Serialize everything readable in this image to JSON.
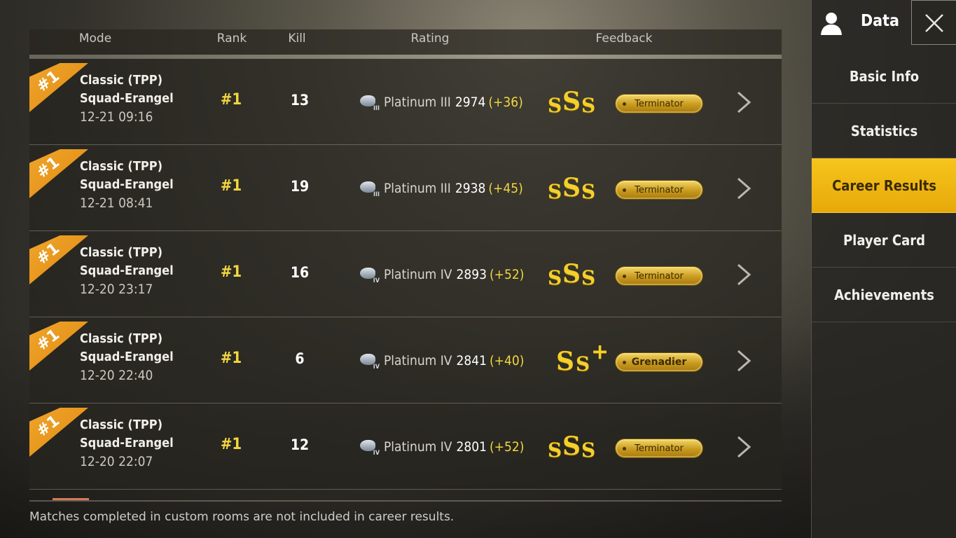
{
  "header": {
    "mode": "Mode",
    "rank": "Rank",
    "kill": "Kill",
    "rating": "Rating",
    "feedback": "Feedback"
  },
  "matches": [
    {
      "badge": "#1",
      "mode_line1": "Classic (TPP)",
      "mode_line2": "Squad-Erangel",
      "time": "12-21 09:16",
      "rank": "#1",
      "kill": "13",
      "tier_icon": "III",
      "tier": "Platinum III",
      "score": "2974",
      "delta": "(+36)",
      "grade": [
        "S",
        "S",
        "S"
      ],
      "grade_plus": false,
      "feedback": "Terminator"
    },
    {
      "badge": "#1",
      "mode_line1": "Classic (TPP)",
      "mode_line2": "Squad-Erangel",
      "time": "12-21 08:41",
      "rank": "#1",
      "kill": "19",
      "tier_icon": "III",
      "tier": "Platinum III",
      "score": "2938",
      "delta": "(+45)",
      "grade": [
        "S",
        "S",
        "S"
      ],
      "grade_plus": false,
      "feedback": "Terminator"
    },
    {
      "badge": "#1",
      "mode_line1": "Classic (TPP)",
      "mode_line2": "Squad-Erangel",
      "time": "12-20 23:17",
      "rank": "#1",
      "kill": "16",
      "tier_icon": "IV",
      "tier": "Platinum IV",
      "score": "2893",
      "delta": "(+52)",
      "grade": [
        "S",
        "S",
        "S"
      ],
      "grade_plus": false,
      "feedback": "Terminator"
    },
    {
      "badge": "#1",
      "mode_line1": "Classic (TPP)",
      "mode_line2": "Squad-Erangel",
      "time": "12-20 22:40",
      "rank": "#1",
      "kill": "6",
      "tier_icon": "IV",
      "tier": "Platinum IV",
      "score": "2841",
      "delta": "(+40)",
      "grade": [
        "S",
        "S",
        "+"
      ],
      "grade_plus": true,
      "feedback": "Grenadier"
    },
    {
      "badge": "#1",
      "mode_line1": "Classic (TPP)",
      "mode_line2": "Squad-Erangel",
      "time": "12-20 22:07",
      "rank": "#1",
      "kill": "12",
      "tier_icon": "IV",
      "tier": "Platinum IV",
      "score": "2801",
      "delta": "(+52)",
      "grade": [
        "S",
        "S",
        "S"
      ],
      "grade_plus": false,
      "feedback": "Terminator"
    }
  ],
  "footnote": "Matches completed in custom rooms are not included in career results.",
  "side": {
    "title": "Data",
    "nav": [
      "Basic Info",
      "Statistics",
      "Career Results",
      "Player Card",
      "Achievements"
    ],
    "active": "Career Results"
  },
  "colors": {
    "accent": "#f2d640",
    "active_tab": "#f6c51c",
    "badge": "#f0a52a"
  },
  "icons": {
    "user": "user-icon",
    "close": "close-icon",
    "chevron": "chevron-right-icon",
    "tier": "tier-helmet-icon"
  }
}
